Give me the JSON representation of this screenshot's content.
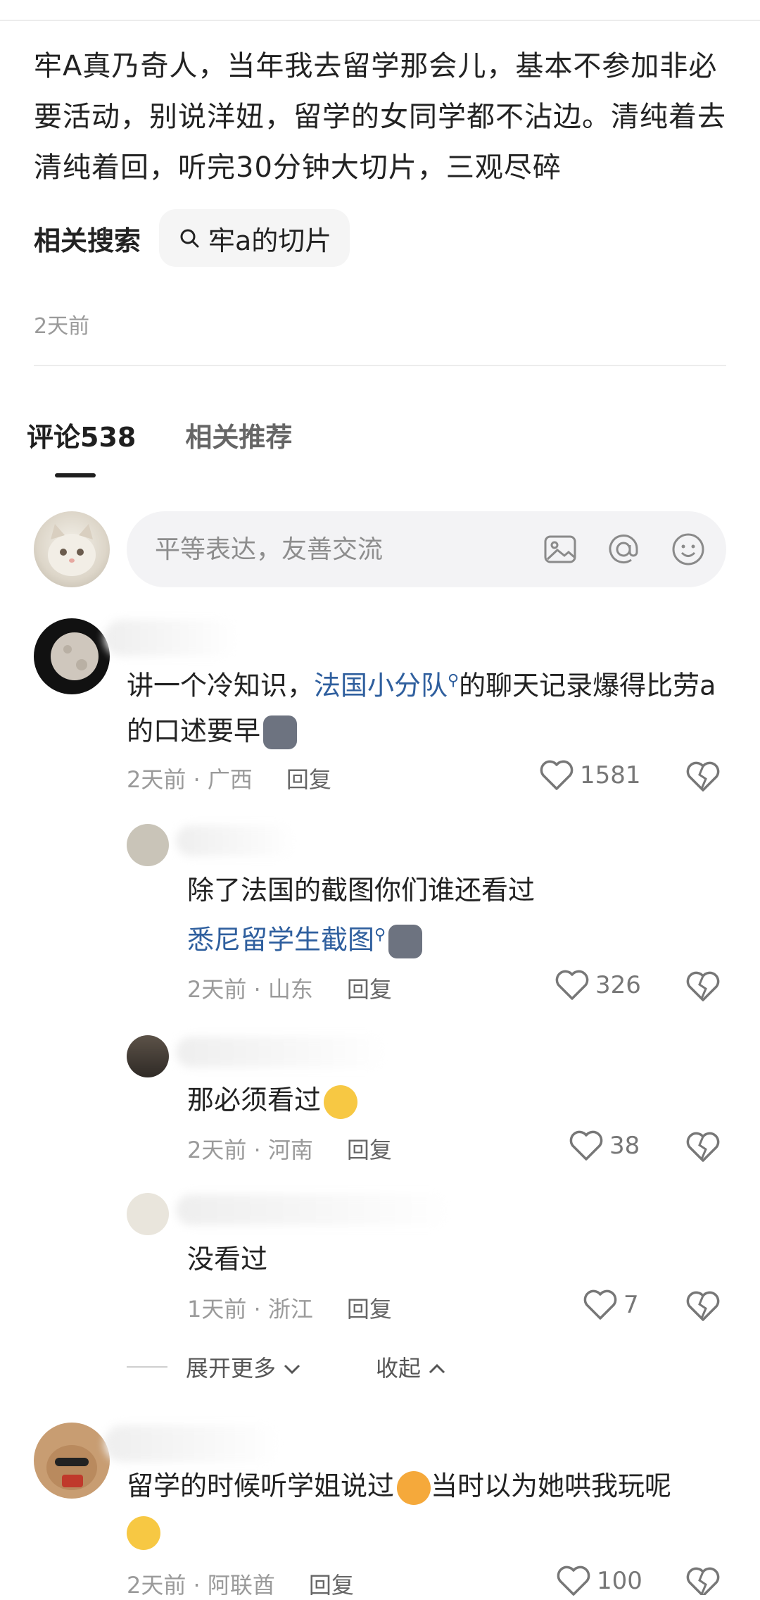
{
  "post": {
    "text": "牢A真乃奇人，当年我去留学那会儿，基本不参加非必要活动，别说洋妞，留学的女同学都不沾边。清纯着去清纯着回，听完30分钟大切片，三观尽碎",
    "related_label": "相关搜索",
    "related_query": "牢a的切片",
    "time": "2天前"
  },
  "tabs": [
    {
      "label": "评论538"
    },
    {
      "label": "相关推荐"
    }
  ],
  "input": {
    "placeholder": "平等表达，友善交流"
  },
  "comments": [
    {
      "text_pre": "讲一个冷知识，",
      "link": "法国小分队",
      "text_post": "的聊天记录爆得比劳a的口述要早",
      "time_loc": "2天前 · 广西",
      "reply": "回复",
      "likes": "1581"
    },
    {
      "text_line1": "除了法国的截图你们谁还看过",
      "link": "悉尼留学生截图",
      "time_loc": "2天前 · 山东",
      "reply": "回复",
      "likes": "326"
    },
    {
      "text": "那必须看过",
      "time_loc": "2天前 · 河南",
      "reply": "回复",
      "likes": "38"
    },
    {
      "text": "没看过",
      "time_loc": "1天前 · 浙江",
      "reply": "回复",
      "likes": "7"
    },
    {
      "text_line1": "留学的时候听学姐说过",
      "text_line1b": "当时以为她哄我玩呢",
      "time_loc": "2天前 · 阿联酋",
      "reply": "回复",
      "likes": "100"
    }
  ],
  "thread": {
    "expand": "展开更多",
    "collapse": "收起"
  },
  "colors": {
    "link": "#2f5f9e",
    "meta": "#9a9a9a"
  },
  "icons": [
    "search-icon",
    "image-icon",
    "at-icon",
    "emoji-icon",
    "heart-icon",
    "broken-heart-icon",
    "chevron-down-icon",
    "chevron-up-icon"
  ]
}
